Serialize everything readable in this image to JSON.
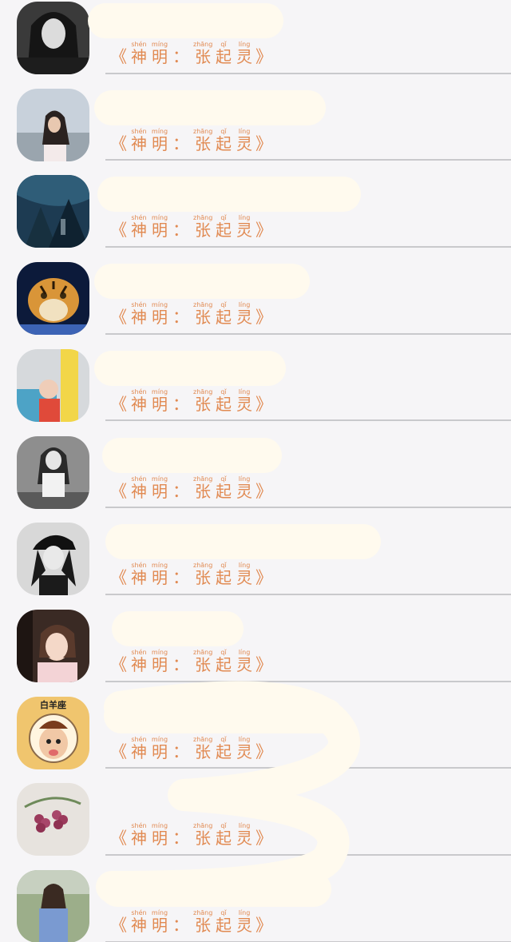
{
  "contacts": [
    {
      "avatar": "avatar-woman-black-and-white",
      "signature": {
        "open": "《",
        "label_chars": [
          {
            "py": "shén",
            "hz": "神"
          },
          {
            "py": "míng",
            "hz": "明"
          }
        ],
        "colon": "：",
        "name_chars": [
          {
            "py": "zhāng",
            "hz": "张"
          },
          {
            "py": "qǐ",
            "hz": "起"
          },
          {
            "py": "líng",
            "hz": "灵"
          }
        ],
        "close": "》"
      }
    },
    {
      "avatar": "avatar-woman-sky",
      "signature": {
        "open": "《",
        "label_chars": [
          {
            "py": "shén",
            "hz": "神"
          },
          {
            "py": "míng",
            "hz": "明"
          }
        ],
        "colon": "：",
        "name_chars": [
          {
            "py": "zhāng",
            "hz": "张"
          },
          {
            "py": "qǐ",
            "hz": "起"
          },
          {
            "py": "líng",
            "hz": "灵"
          }
        ],
        "close": "》"
      }
    },
    {
      "avatar": "avatar-forest-scene",
      "signature": {
        "open": "《",
        "label_chars": [
          {
            "py": "shén",
            "hz": "神"
          },
          {
            "py": "míng",
            "hz": "明"
          }
        ],
        "colon": "：",
        "name_chars": [
          {
            "py": "zhāng",
            "hz": "张"
          },
          {
            "py": "qǐ",
            "hz": "起"
          },
          {
            "py": "líng",
            "hz": "灵"
          }
        ],
        "close": "》"
      }
    },
    {
      "avatar": "avatar-tiger",
      "signature": {
        "open": "《",
        "label_chars": [
          {
            "py": "shén",
            "hz": "神"
          },
          {
            "py": "míng",
            "hz": "明"
          }
        ],
        "colon": "：",
        "name_chars": [
          {
            "py": "zhāng",
            "hz": "张"
          },
          {
            "py": "qǐ",
            "hz": "起"
          },
          {
            "py": "líng",
            "hz": "灵"
          }
        ],
        "close": "》"
      }
    },
    {
      "avatar": "avatar-child-with-banner",
      "signature": {
        "open": "《",
        "label_chars": [
          {
            "py": "shén",
            "hz": "神"
          },
          {
            "py": "míng",
            "hz": "明"
          }
        ],
        "colon": "：",
        "name_chars": [
          {
            "py": "zhāng",
            "hz": "张"
          },
          {
            "py": "qǐ",
            "hz": "起"
          },
          {
            "py": "líng",
            "hz": "灵"
          }
        ],
        "close": "》"
      }
    },
    {
      "avatar": "avatar-woman-grayscale",
      "signature": {
        "open": "《",
        "label_chars": [
          {
            "py": "shén",
            "hz": "神"
          },
          {
            "py": "míng",
            "hz": "明"
          }
        ],
        "colon": "：",
        "name_chars": [
          {
            "py": "zhāng",
            "hz": "张"
          },
          {
            "py": "qǐ",
            "hz": "起"
          },
          {
            "py": "líng",
            "hz": "灵"
          }
        ],
        "close": "》"
      }
    },
    {
      "avatar": "avatar-woman-black-cap",
      "signature": {
        "open": "《",
        "label_chars": [
          {
            "py": "shén",
            "hz": "神"
          },
          {
            "py": "míng",
            "hz": "明"
          }
        ],
        "colon": "：",
        "name_chars": [
          {
            "py": "zhāng",
            "hz": "张"
          },
          {
            "py": "qǐ",
            "hz": "起"
          },
          {
            "py": "líng",
            "hz": "灵"
          }
        ],
        "close": "》"
      }
    },
    {
      "avatar": "avatar-woman-hands-on-face",
      "signature": {
        "open": "《",
        "label_chars": [
          {
            "py": "shén",
            "hz": "神"
          },
          {
            "py": "míng",
            "hz": "明"
          }
        ],
        "colon": "：",
        "name_chars": [
          {
            "py": "zhāng",
            "hz": "张"
          },
          {
            "py": "qǐ",
            "hz": "起"
          },
          {
            "py": "líng",
            "hz": "灵"
          }
        ],
        "close": "》"
      }
    },
    {
      "avatar": "avatar-sheep-cartoon",
      "avatar_caption": "白羊座",
      "signature": {
        "open": "《",
        "label_chars": [
          {
            "py": "shén",
            "hz": "神"
          },
          {
            "py": "míng",
            "hz": "明"
          }
        ],
        "colon": "：",
        "name_chars": [
          {
            "py": "zhāng",
            "hz": "张"
          },
          {
            "py": "qǐ",
            "hz": "起"
          },
          {
            "py": "líng",
            "hz": "灵"
          }
        ],
        "close": "》"
      }
    },
    {
      "avatar": "avatar-grapes-painting",
      "signature": {
        "open": "《",
        "label_chars": [
          {
            "py": "shén",
            "hz": "神"
          },
          {
            "py": "míng",
            "hz": "明"
          }
        ],
        "colon": "：",
        "name_chars": [
          {
            "py": "zhāng",
            "hz": "张"
          },
          {
            "py": "qǐ",
            "hz": "起"
          },
          {
            "py": "líng",
            "hz": "灵"
          }
        ],
        "close": "》"
      }
    },
    {
      "avatar": "avatar-woman-outdoors",
      "signature": {
        "open": "《",
        "label_chars": [
          {
            "py": "shén",
            "hz": "神"
          },
          {
            "py": "míng",
            "hz": "明"
          }
        ],
        "colon": "：",
        "name_chars": [
          {
            "py": "zhāng",
            "hz": "张"
          },
          {
            "py": "qǐ",
            "hz": "起"
          },
          {
            "py": "líng",
            "hz": "灵"
          }
        ],
        "close": "》"
      }
    }
  ],
  "colors": {
    "background": "#f6f5f7",
    "signature_text": "#e18a52",
    "divider": "#c9c9cc",
    "redaction": "#fffaee"
  }
}
